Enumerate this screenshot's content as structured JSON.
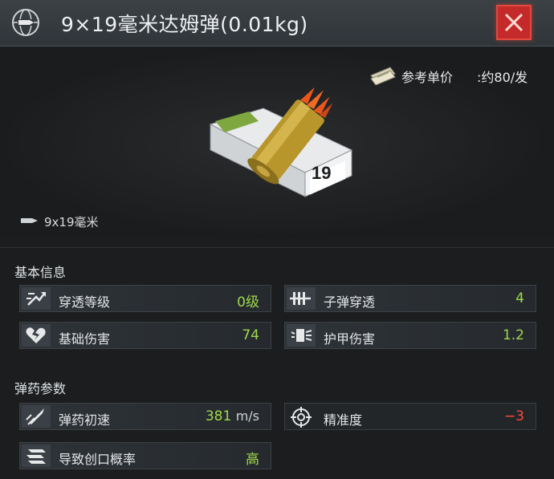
{
  "window": {
    "title": "9×19毫米达姆弹(0.01kg)",
    "close_icon": "close-x-icon",
    "accent_red": "#c42a2a"
  },
  "price": {
    "label": "参考单价",
    "value": ":约80/发",
    "icon": "cash-stack-icon"
  },
  "item": {
    "caliber": "9x19毫米",
    "caliber_icon": "bullet-icon",
    "image": "ammo-box-with-bullet"
  },
  "basic_info": {
    "title": "基本信息",
    "stats": [
      {
        "label": "穿透等级",
        "value": "0级",
        "icon": "penetration-level-icon"
      },
      {
        "label": "子弹穿透",
        "value": "4",
        "icon": "bullet-penetration-icon"
      },
      {
        "label": "基础伤害",
        "value": "74",
        "icon": "broken-heart-icon"
      },
      {
        "label": "护甲伤害",
        "value": "1.2",
        "icon": "armor-damage-icon"
      }
    ]
  },
  "ammo_params": {
    "title": "弹药参数",
    "stats": [
      {
        "label": "弹药初速",
        "value": "381",
        "unit": "m/s",
        "icon": "muzzle-velocity-icon"
      },
      {
        "label": "精准度",
        "value": "−3",
        "icon": "crosshair-icon"
      },
      {
        "label": "导致创口概率",
        "value": "高",
        "icon": "wound-chance-icon"
      }
    ]
  },
  "colors": {
    "positive": "#9fd84a",
    "negative": "#ff4a38",
    "panel_bg": "#1b1d1f"
  }
}
